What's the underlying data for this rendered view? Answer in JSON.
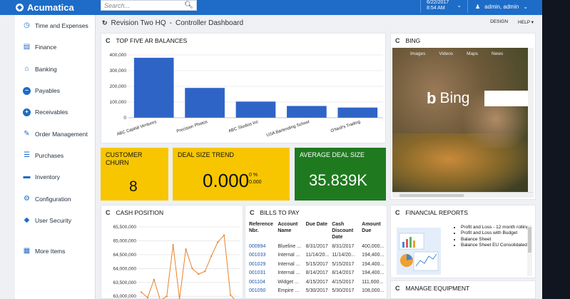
{
  "app": {
    "brand": "Acumatica",
    "search_placeholder": "Search...",
    "date": "6/22/2017",
    "time": "8:54 AM",
    "user": "admin, admin"
  },
  "sidebar": {
    "items": [
      {
        "label": "Time and Expenses",
        "icon": "clock-icon"
      },
      {
        "label": "Finance",
        "icon": "finance-icon"
      },
      {
        "label": "Banking",
        "icon": "bank-icon"
      },
      {
        "label": "Payables",
        "icon": "minus-circle-icon"
      },
      {
        "label": "Receivables",
        "icon": "plus-circle-icon"
      },
      {
        "label": "Order Management",
        "icon": "edit-icon"
      },
      {
        "label": "Purchases",
        "icon": "cart-icon"
      },
      {
        "label": "Inventory",
        "icon": "truck-icon"
      },
      {
        "label": "Configuration",
        "icon": "gear-icon"
      },
      {
        "label": "User Security",
        "icon": "shield-icon"
      }
    ],
    "more_label": "More Items"
  },
  "header": {
    "company": "Revision Two HQ",
    "separator": "-",
    "dashboard": "Controller Dashboard",
    "design_label": "DESIGN",
    "help_label": "HELP"
  },
  "widgets": {
    "ar_title": "TOP FIVE AR BALANCES",
    "bing_title": "BING",
    "cash_title": "CASH POSITION",
    "bills_title": "BILLS TO PAY",
    "fin_title": "FINANCIAL REPORTS",
    "equip_title": "MANAGE EQUIPMENT"
  },
  "kpis": {
    "churn_title": "CUSTOMER CHURN",
    "churn_value": "8",
    "trend_title": "DEAL SIZE TREND",
    "trend_value": "0.000",
    "trend_sub1": "0 %",
    "trend_sub2": "0.000",
    "avg_title": "AVERAGE DEAL SIZE",
    "avg_value": "35.839K"
  },
  "bing": {
    "nav": [
      "Images",
      "Videos",
      "Maps",
      "News"
    ],
    "logo_text": "Bing",
    "logo_glyph": "b"
  },
  "bills": {
    "headers": [
      "Reference Nbr.",
      "Account Name",
      "Due Date",
      "Cash Discount Date",
      "Amount Due"
    ],
    "rows": [
      [
        "000994",
        "Blueline ...",
        "8/31/2017",
        "8/31/2017",
        "400,000..."
      ],
      [
        "001033",
        "Internal ...",
        "11/14/20...",
        "11/14/20...",
        "194,400..."
      ],
      [
        "001029",
        "Internal ...",
        "5/15/2017",
        "5/15/2017",
        "194,400..."
      ],
      [
        "001031",
        "Internal ...",
        "8/14/2017",
        "8/14/2017",
        "194,400..."
      ],
      [
        "001104",
        "Widget ...",
        "4/15/2017",
        "4/15/2017",
        "111,600..."
      ],
      [
        "001050",
        "Empire ...",
        "5/30/2017",
        "5/30/2017",
        "108,000..."
      ]
    ]
  },
  "financial_reports": [
    "Profit and Loss - 12 month rolling",
    "Profit and Loss with Budget",
    "Balance Sheet",
    "Balance Sheet EU Consolidated"
  ],
  "chart_data": [
    {
      "type": "bar",
      "categories": [
        "ABC Capital Ventures",
        "Precision Photos",
        "ABC Studios Inc",
        "USA Bartending School",
        "O'Neill's Trading"
      ],
      "values": [
        382000,
        190000,
        103000,
        75000,
        65000
      ],
      "ylim": [
        0,
        400000
      ],
      "yticks": [
        "0",
        "100,000",
        "200,000",
        "300,000",
        "400,000"
      ],
      "color": "#2f64c7",
      "grid": true
    },
    {
      "type": "line",
      "x": [
        1,
        2,
        3,
        4,
        5,
        6,
        7,
        8,
        9,
        10,
        11,
        12,
        13,
        14,
        15,
        16
      ],
      "values": [
        63150000,
        62950000,
        63600000,
        62850000,
        63000000,
        64850000,
        62900000,
        64700000,
        64000000,
        63800000,
        63900000,
        64450000,
        64950000,
        65200000,
        63050000,
        62800000
      ],
      "ylim": [
        62800000,
        65500000
      ],
      "yticks": [
        "63,000,000",
        "63,500,000",
        "64,000,000",
        "64,500,000",
        "65,000,000",
        "65,500,000"
      ],
      "color": "#e8822a",
      "grid": true
    }
  ]
}
